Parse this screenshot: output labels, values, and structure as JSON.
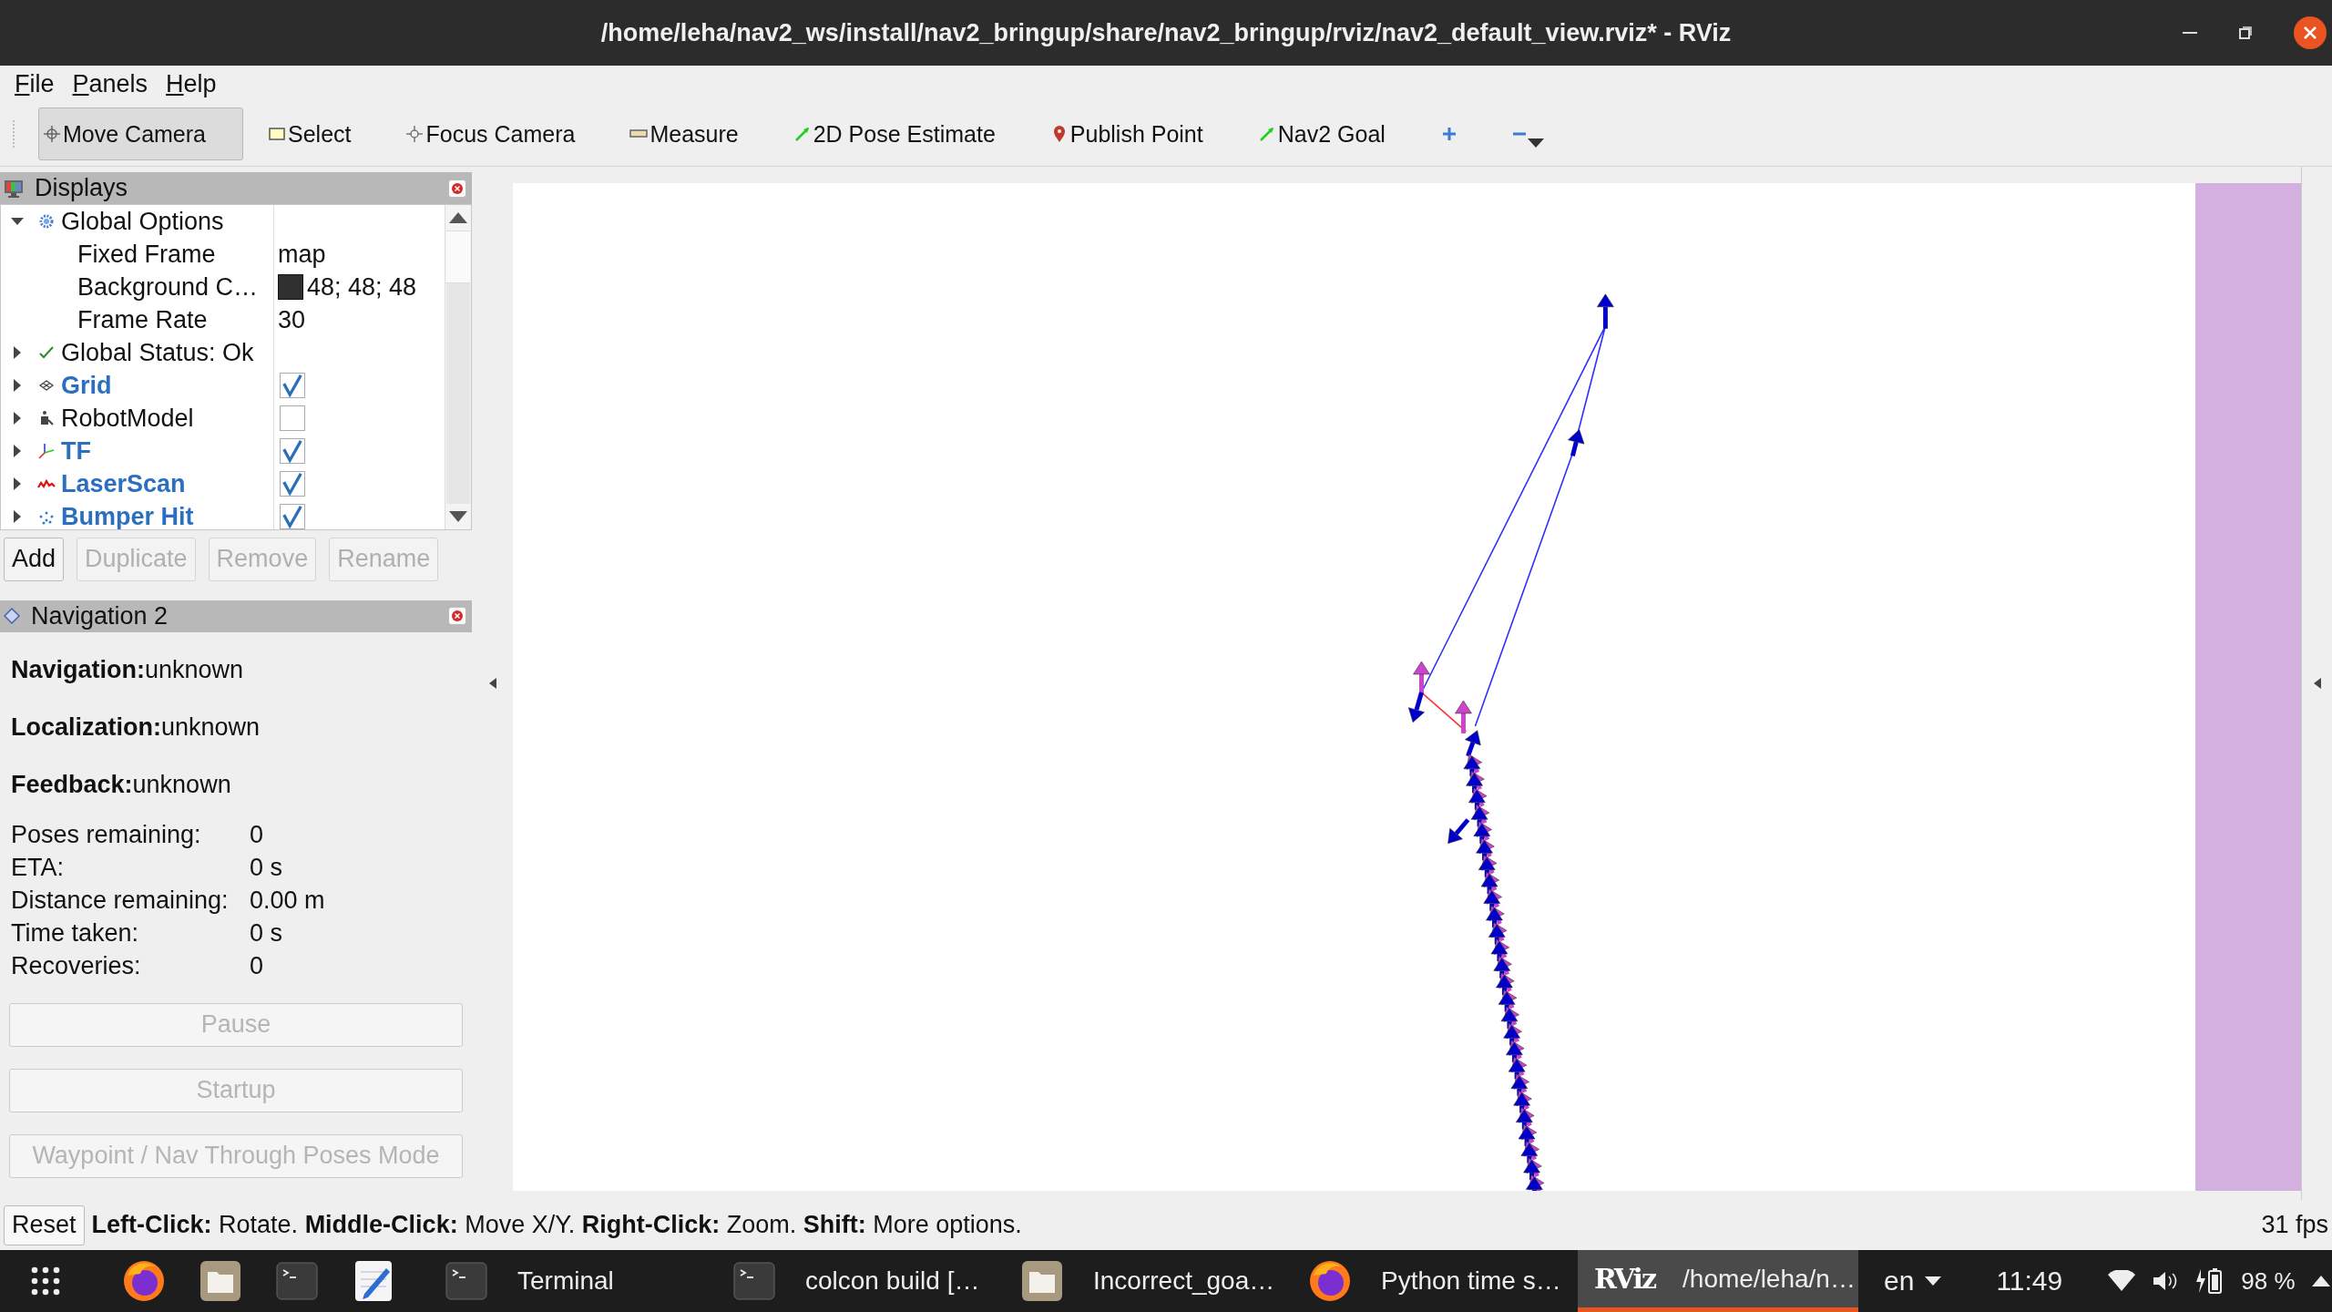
{
  "window": {
    "title": "/home/leha/nav2_ws/install/nav2_bringup/share/nav2_bringup/rviz/nav2_default_view.rviz* - RViz"
  },
  "menu": [
    {
      "label": "File"
    },
    {
      "label": "Panels"
    },
    {
      "label": "Help"
    }
  ],
  "toolbar": [
    {
      "kind": "move",
      "label": "Move Camera",
      "selected": true
    },
    {
      "kind": "select",
      "label": "Select",
      "selected": false
    },
    {
      "kind": "focus",
      "label": "Focus Camera",
      "selected": false
    },
    {
      "kind": "measure",
      "label": "Measure",
      "selected": false
    },
    {
      "kind": "pose",
      "label": "2D Pose Estimate",
      "selected": false
    },
    {
      "kind": "point",
      "label": "Publish Point",
      "selected": false
    },
    {
      "kind": "goal",
      "label": "Nav2 Goal",
      "selected": false
    },
    {
      "kind": "add",
      "selected": false
    },
    {
      "kind": "remove",
      "selected": false
    }
  ],
  "displays": {
    "title": "Displays",
    "tree": [
      {
        "kind": "options",
        "label": "Global Options",
        "expanded": true,
        "children": [
          {
            "label": "Fixed Frame",
            "value": "map"
          },
          {
            "label": "Background C…",
            "value": "48; 48; 48",
            "color": "#303030"
          },
          {
            "label": "Frame Rate",
            "value": "30"
          }
        ]
      },
      {
        "kind": "status",
        "label": "Global Status: Ok",
        "expanded": false
      },
      {
        "kind": "grid",
        "label": "Grid",
        "expanded": false,
        "checked": true
      },
      {
        "kind": "robot",
        "label": "RobotModel",
        "expanded": false,
        "checked": false
      },
      {
        "kind": "tf",
        "label": "TF",
        "expanded": false,
        "checked": true
      },
      {
        "kind": "laser",
        "label": "LaserScan",
        "expanded": false,
        "checked": true
      },
      {
        "kind": "bumper",
        "label": "Bumper Hit",
        "expanded": false,
        "checked": true
      }
    ],
    "buttons": [
      {
        "label": "Add",
        "disabled": false
      },
      {
        "label": "Duplicate",
        "disabled": true
      },
      {
        "label": "Remove",
        "disabled": true
      },
      {
        "label": "Rename",
        "disabled": true
      }
    ]
  },
  "navigation": {
    "title": "Navigation 2",
    "status": [
      {
        "label": "Navigation:",
        "value": "unknown"
      },
      {
        "label": "Localization:",
        "value": "unknown"
      },
      {
        "label": "Feedback:",
        "value": "unknown"
      }
    ],
    "stats": [
      {
        "label": "Poses remaining:",
        "value": "0"
      },
      {
        "label": "ETA:",
        "value": "0 s"
      },
      {
        "label": "Distance remaining:",
        "value": "0.00 m"
      },
      {
        "label": "Time taken:",
        "value": "0 s"
      },
      {
        "label": "Recoveries:",
        "value": "0"
      }
    ],
    "buttons": [
      {
        "label": "Pause",
        "disabled": true
      },
      {
        "label": "Startup",
        "disabled": true
      },
      {
        "label": "Waypoint / Nav Through Poses Mode",
        "disabled": true
      }
    ]
  },
  "status_bar": {
    "reset": "Reset",
    "hint": "**Left-Click:** Rotate. **Middle-Click:** Move X/Y. **Right-Click:** Zoom. **Shift:** More options.",
    "fps": "31 fps"
  },
  "taskbar": {
    "apps": [
      {
        "kind": "firefox",
        "selected": false
      },
      {
        "kind": "files",
        "selected": false
      },
      {
        "kind": "terminal",
        "selected": false
      },
      {
        "kind": "editor",
        "selected": false
      },
      {
        "kind": "terminal",
        "label": "Terminal",
        "selected": false
      },
      {
        "kind": "terminal",
        "label": "colcon build […",
        "selected": false
      },
      {
        "kind": "files",
        "label": "Incorrect_goa…",
        "selected": false
      },
      {
        "kind": "firefox",
        "label": "Python time s…",
        "selected": false
      },
      {
        "kind": "rviz",
        "logo": "RViz",
        "label": "/home/leha/n…",
        "selected": true
      }
    ],
    "language": "en",
    "clock": "11:49",
    "battery": "98 %"
  }
}
